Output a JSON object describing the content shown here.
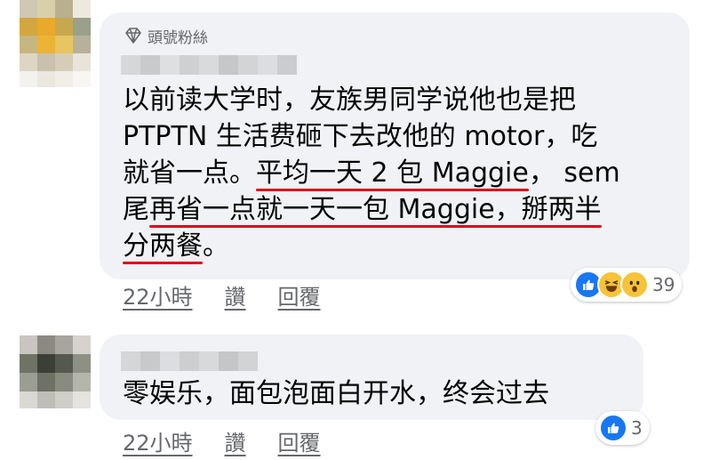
{
  "comments": [
    {
      "badge": "頭號粉絲",
      "lines": [
        {
          "segments": [
            {
              "text": "以前读大学时，友族男同学说他也是把"
            }
          ]
        },
        {
          "segments": [
            {
              "text": "PTPTN 生活费砸下去改他的 motor，吃"
            }
          ]
        },
        {
          "segments": [
            {
              "text": "就省一点。"
            },
            {
              "text": "平均一天 2 包 Maggie",
              "underline": true
            },
            {
              "text": "，  sem"
            }
          ]
        },
        {
          "segments": [
            {
              "text": "尾"
            },
            {
              "text": "再省一点就一天一包 Maggie，掰两半",
              "underline": true
            }
          ]
        },
        {
          "segments": [
            {
              "text": "分两餐",
              "underline": true
            },
            {
              "text": "。"
            }
          ]
        }
      ],
      "time": "22小時",
      "like_label": "讚",
      "reply_label": "回覆",
      "reactions": {
        "types": [
          "like",
          "haha",
          "wow"
        ],
        "count": "39"
      }
    },
    {
      "text": "零娱乐，面包泡面白开水，终会过去",
      "time": "22小時",
      "like_label": "讚",
      "reply_label": "回覆",
      "reactions": {
        "types": [
          "like"
        ],
        "count": "3"
      }
    }
  ],
  "colors": {
    "bubble": "#f0f2f5",
    "underline": "#e0001b",
    "meta_text": "#65676b",
    "like_blue": "#1877f2",
    "emoji_yellow": "#f7c339"
  }
}
